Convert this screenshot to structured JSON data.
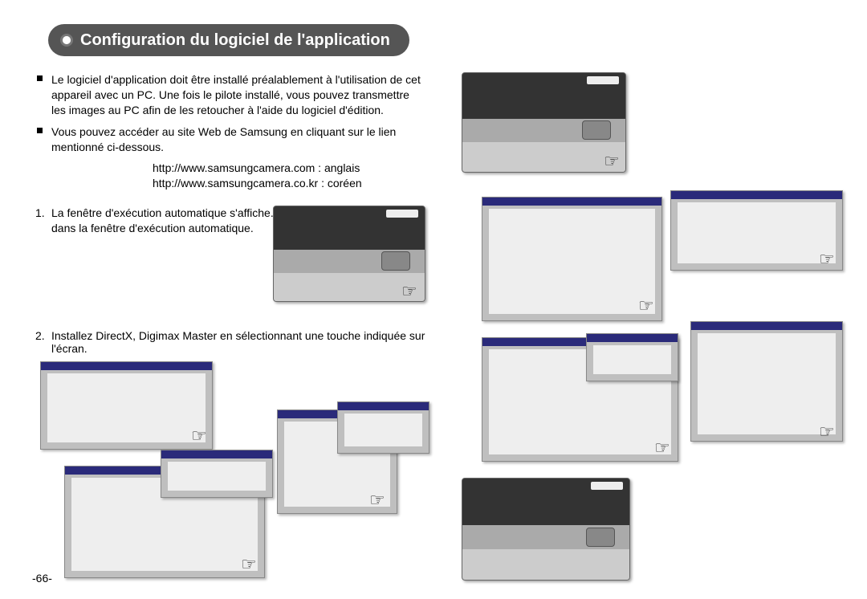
{
  "title": "Configuration du logiciel de l'application",
  "bullets": {
    "b1": "Le logiciel d'application doit être installé préalablement à l'utilisation de cet appareil avec un PC. Une fois le pilote installé, vous pouvez transmettre les images au PC afin de les retoucher à l'aide du logiciel d'édition.",
    "b2": "Vous pouvez accéder au site Web de Samsung en cliquant sur le lien mentionné ci-dessous."
  },
  "links": {
    "l1": "http://www.samsungcamera.com : anglais",
    "l2": "http://www.samsungcamera.co.kr : coréen"
  },
  "steps": {
    "s1": "La fenêtre d'exécution automatique s'affiche.  Cliquez sur le menu [Installer] dans la fenêtre d'exécution automatique.",
    "s2": "Installez DirectX, Digimax Master en sélectionnant une touche indiquée sur l'écran."
  },
  "page": "-66-"
}
